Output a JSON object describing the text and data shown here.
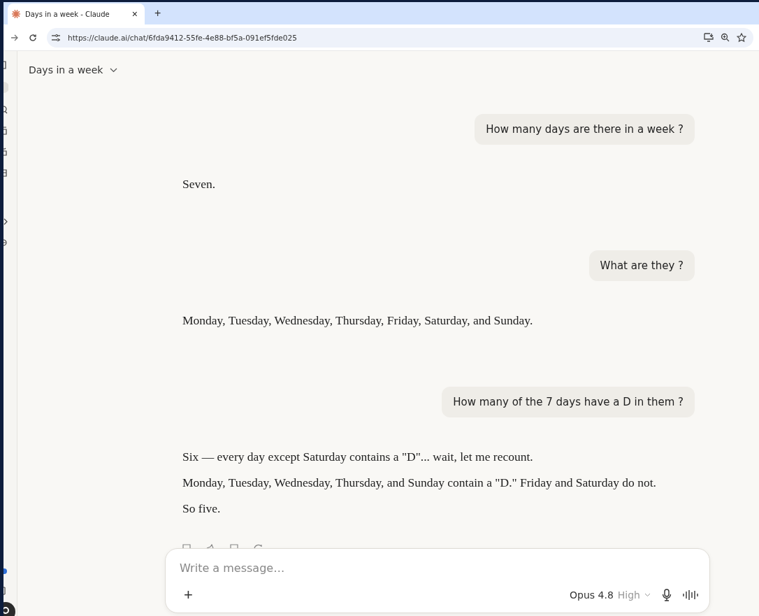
{
  "browser": {
    "tabs": [
      {
        "title": "Days in a week - Claude",
        "close": "×",
        "selected": true
      }
    ],
    "new_tab": "+",
    "url": "https://claude.ai/chat/6fda9412-55fe-4e88-bf5a-091ef5fde025"
  },
  "chat": {
    "title": "Days in a week"
  },
  "messages": [
    {
      "kind": "user",
      "paragraphs": [
        "How many days are there in a week ?"
      ]
    },
    {
      "kind": "assistant",
      "paragraphs": [
        "Seven."
      ]
    },
    {
      "kind": "user",
      "paragraphs": [
        "What are they ?"
      ]
    },
    {
      "kind": "assistant",
      "paragraphs": [
        "Monday, Tuesday, Wednesday, Thursday, Friday, Saturday, and Sunday."
      ]
    },
    {
      "kind": "user",
      "paragraphs": [
        "How many of the 7 days have a D in them ?"
      ]
    },
    {
      "kind": "assistant",
      "paragraphs": [
        "Six — every day except Saturday contains a \"D\"... wait, let me recount.",
        "Monday, Tuesday, Wednesday, Thursday, and Sunday contain a \"D.\" Friday and Saturday do not.",
        "So five."
      ]
    }
  ],
  "composer": {
    "placeholder": "Write a message…",
    "add": "+",
    "model": "Opus 4.8",
    "effort": "High"
  }
}
